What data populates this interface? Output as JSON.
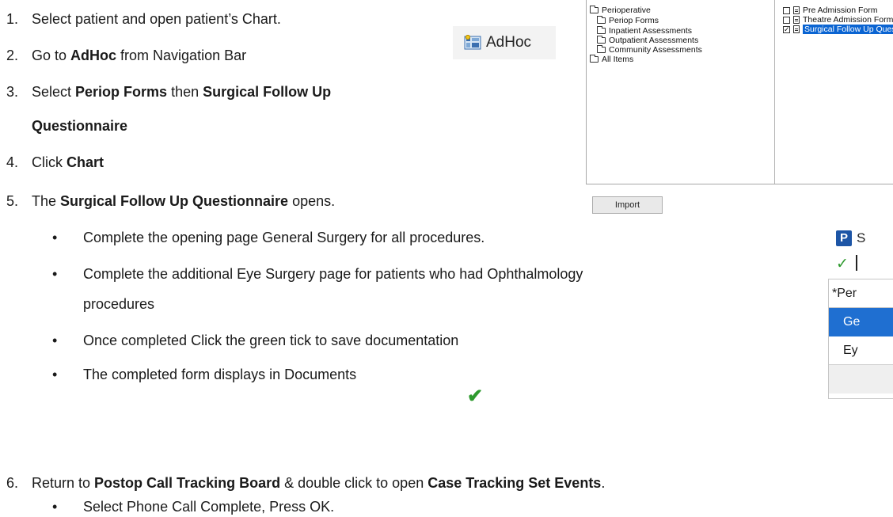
{
  "steps": [
    {
      "num": "1.",
      "parts": [
        {
          "t": "Select patient and open patient’s Chart.",
          "b": false
        }
      ]
    },
    {
      "num": "2.",
      "parts": [
        {
          "t": "Go to ",
          "b": false
        },
        {
          "t": "AdHoc",
          "b": true
        },
        {
          "t": " from Navigation  Bar",
          "b": false
        }
      ]
    },
    {
      "num": "3.",
      "parts": [
        {
          "t": "Select ",
          "b": false
        },
        {
          "t": "Periop Forms",
          "b": true
        },
        {
          "t": " then ",
          "b": false
        },
        {
          "t": "Surgical Follow Up",
          "b": true
        }
      ]
    },
    {
      "num": "",
      "parts": [
        {
          "t": "Questionnaire",
          "b": true
        }
      ]
    },
    {
      "num": "4.",
      "parts": [
        {
          "t": "Click ",
          "b": false
        },
        {
          "t": "Chart",
          "b": true
        }
      ]
    },
    {
      "num": "5.",
      "parts": [
        {
          "t": "The ",
          "b": false
        },
        {
          "t": "Surgical Follow Up Questionnaire",
          "b": true
        },
        {
          "t": " opens.",
          "b": false
        }
      ]
    },
    {
      "num": "6.",
      "parts": [
        {
          "t": "Return to ",
          "b": false
        },
        {
          "t": "Postop Call Tracking Board",
          "b": true
        },
        {
          "t": " & double  click to open ",
          "b": false
        },
        {
          "t": "Case Tracking Set Events",
          "b": true
        },
        {
          "t": ".",
          "b": false
        }
      ]
    }
  ],
  "bullets": [
    "Complete the opening page General Surgery for all procedures.",
    "Complete the additional Eye Surgery page for patients who had Ophthalmology",
    "procedures",
    "Once completed Click the green tick to save documentation",
    "The completed form displays in Documents",
    "Select Phone Call Complete, Press OK."
  ],
  "bullet_char": "•",
  "adhoc_button": {
    "label": "AdHoc",
    "icon": "adhoc-grid-icon"
  },
  "folder_tree": [
    {
      "label": "Perioperative",
      "level": 0
    },
    {
      "label": "Periop Forms",
      "level": 1
    },
    {
      "label": "Inpatient Assessments",
      "level": 1
    },
    {
      "label": "Outpatient Assessments",
      "level": 1
    },
    {
      "label": "Community Assessments",
      "level": 1
    },
    {
      "label": "All Items",
      "level": 0
    }
  ],
  "forms": [
    {
      "label": "Pre Admission Form",
      "checked": false,
      "selected": false
    },
    {
      "label": "Theatre Admission Form",
      "checked": false,
      "selected": false
    },
    {
      "label": "Surgical Follow Up Questionnaire",
      "checked": true,
      "selected": true
    }
  ],
  "import_label": "Import",
  "right_window": {
    "title": "S",
    "tick": "✓",
    "rows": [
      {
        "label": "*Per",
        "kind": "hdr"
      },
      {
        "label": "Ge",
        "kind": "active"
      },
      {
        "label": "Ey",
        "kind": "plain"
      },
      {
        "label": "",
        "kind": "empty"
      }
    ]
  },
  "green_tick": "✔",
  "colors": {
    "accent": "#1f6fd1",
    "selection": "#0a64d2",
    "tick_green": "#2e9a2e"
  }
}
